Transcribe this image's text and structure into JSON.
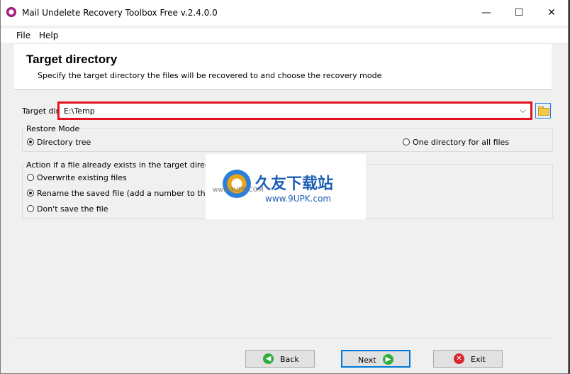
{
  "window": {
    "title": "Mail Undelete Recovery Toolbox Free v.2.4.0.0",
    "controls": {
      "minimize": "—",
      "maximize": "☐",
      "close": "✕"
    }
  },
  "menu": {
    "file": "File",
    "help": "Help"
  },
  "header": {
    "title": "Target directory",
    "subtitle": "Specify the target directory the files will be recovered to and choose the recovery mode"
  },
  "target": {
    "label": "Target dir:",
    "value": "E:\\Temp",
    "chevron": "⌵",
    "highlight_color": "#e2141f"
  },
  "restore_mode": {
    "title": "Restore Mode",
    "options": [
      {
        "label": "Directory tree",
        "selected": true
      },
      {
        "label": "One directory for all files",
        "selected": false
      }
    ]
  },
  "action": {
    "title": "Action if a file already exists in the target directory",
    "options": [
      {
        "label": "Overwrite existing files",
        "selected": false
      },
      {
        "label": "Rename the saved file (add a number to the end",
        "selected": true
      },
      {
        "label": "Don't save the file",
        "selected": false
      }
    ]
  },
  "watermark": {
    "brand": "久友下载站",
    "url": "www.9UPK.com",
    "prefix": "www.9UPK.COM"
  },
  "buttons": {
    "back": "Back",
    "next": "Next",
    "exit": "Exit",
    "back_icon": "◀",
    "next_icon": "▶",
    "exit_icon": "✕"
  }
}
